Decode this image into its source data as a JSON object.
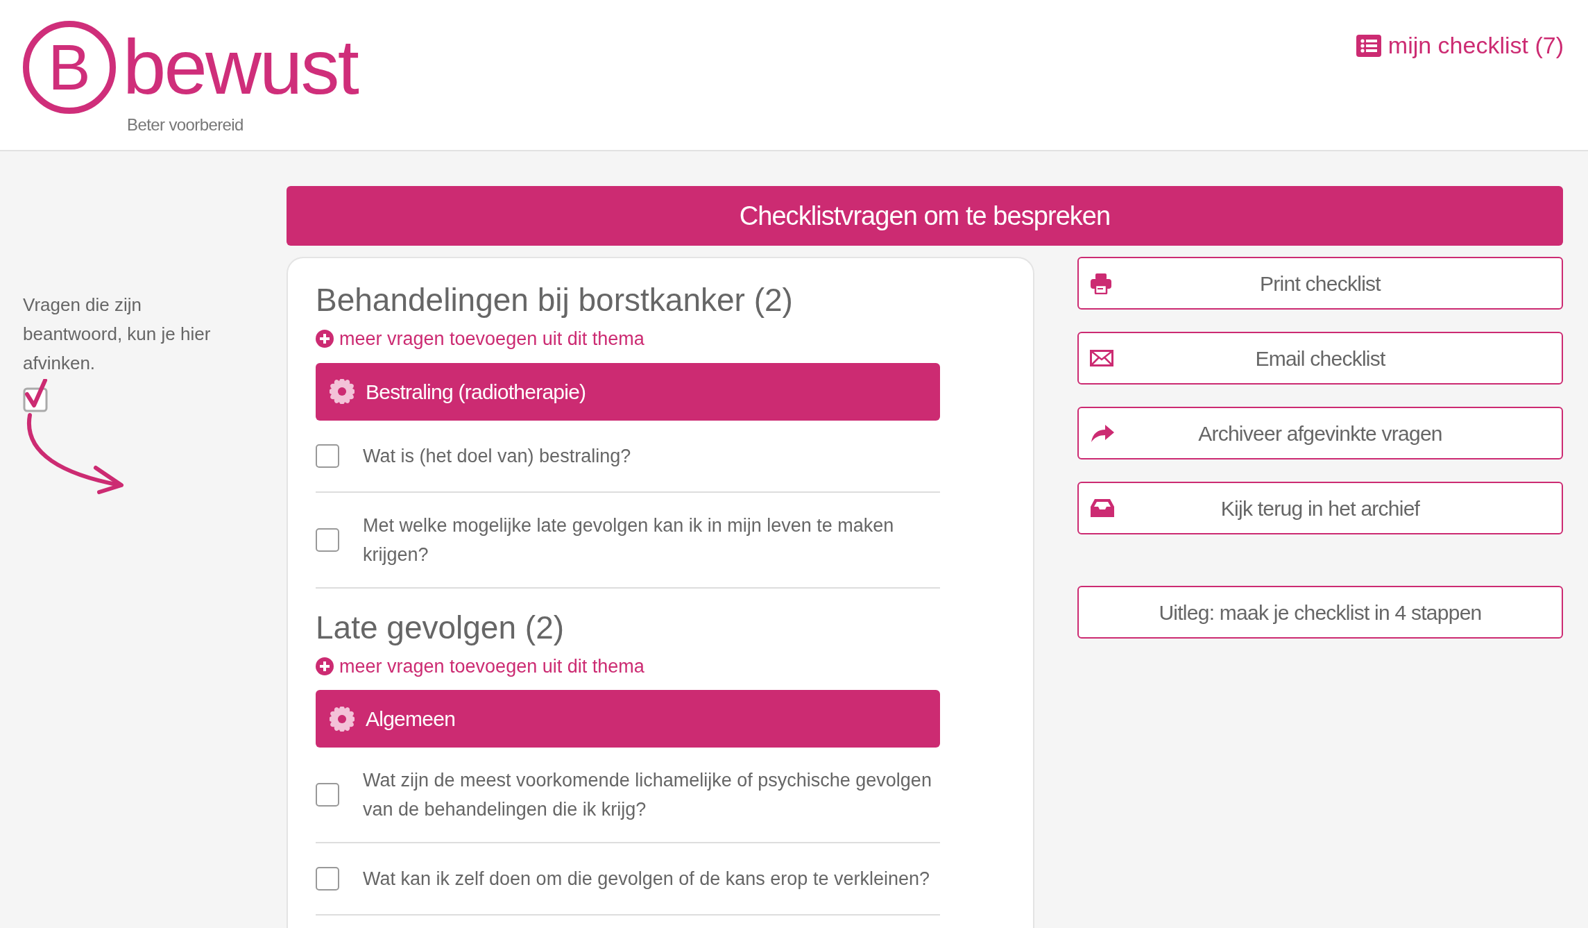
{
  "logo": {
    "letter": "B",
    "name": "bewust",
    "tagline": "Beter voorbereid"
  },
  "checklist_link": {
    "label": "mijn checklist (7)"
  },
  "banner": {
    "title": "Checklistvragen om te bespreken"
  },
  "hint": {
    "text": "Vragen die zijn beantwoord, kun je hier afvinken."
  },
  "sections": [
    {
      "title": "Behandelingen bij borstkanker (2)",
      "add_link": "meer vragen toevoegen uit dit thema",
      "categories": [
        {
          "title": "Bestraling (radiotherapie)",
          "questions": [
            {
              "text": "Wat is (het doel van) bestraling?",
              "checked": false
            },
            {
              "text": "Met welke mogelijke late gevolgen kan ik in mijn leven te maken krijgen?",
              "checked": false
            }
          ]
        }
      ]
    },
    {
      "title": "Late gevolgen (2)",
      "add_link": "meer vragen toevoegen uit dit thema",
      "categories": [
        {
          "title": "Algemeen",
          "questions": [
            {
              "text": "Wat zijn de meest voorkomende lichamelijke of psychische gevolgen van de behandelingen die ik krijg?",
              "checked": false
            },
            {
              "text": "Wat kan ik zelf doen om die gevolgen of de kans erop te verkleinen?",
              "checked": false
            }
          ]
        }
      ]
    }
  ],
  "actions": [
    {
      "label": "Print checklist",
      "kind": "print"
    },
    {
      "label": "Email checklist",
      "kind": "email"
    },
    {
      "label": "Archiveer afgevinkte vragen",
      "kind": "archive"
    },
    {
      "label": "Kijk terug in het archief",
      "kind": "inbox"
    },
    {
      "label": "Uitleg: maak je checklist in 4 stappen",
      "kind": "help"
    }
  ]
}
